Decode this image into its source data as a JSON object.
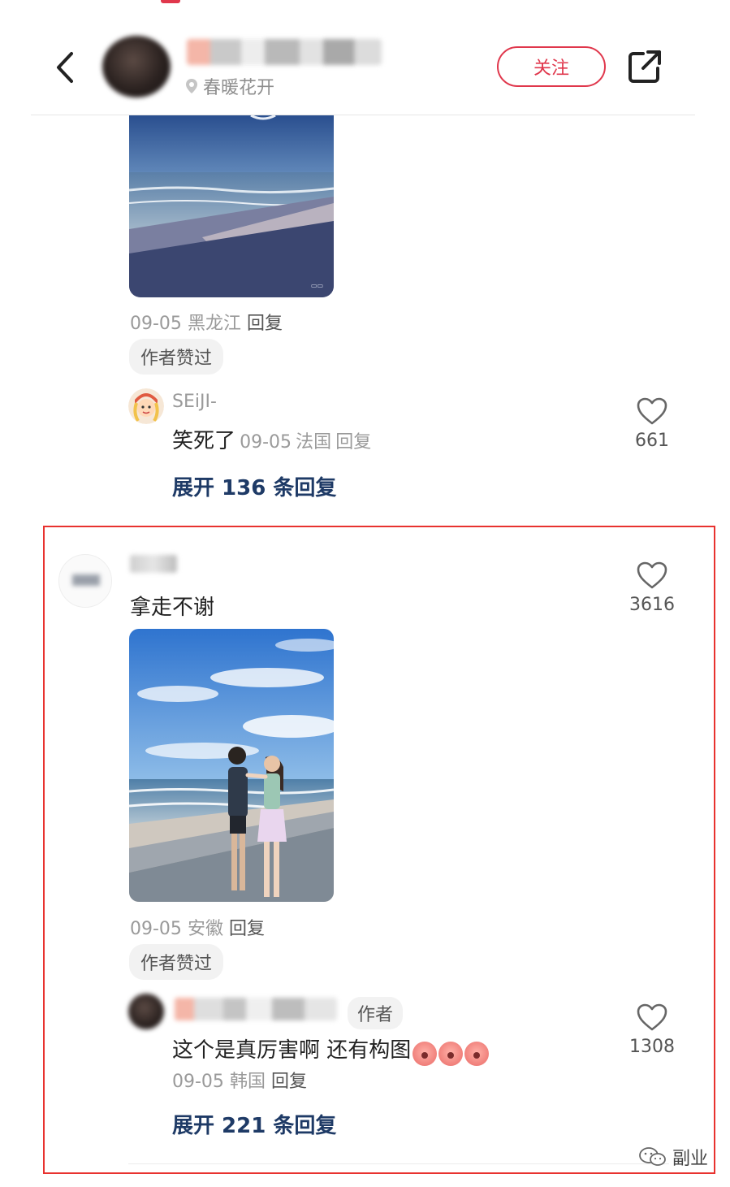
{
  "header": {
    "location": "春暖花开",
    "follow_label": "关注"
  },
  "comments": [
    {
      "meta_date": "09-05",
      "meta_region": "黑龙江",
      "meta_reply": "回复",
      "liked_by_author": "作者赞过",
      "sub_reply": {
        "username": "SEiJI-",
        "text": "笑死了",
        "date": "09-05",
        "region": "法国",
        "reply_label": "回复",
        "likes": "661"
      },
      "expand_label": "展开 136 条回复"
    },
    {
      "text": "拿走不谢",
      "likes": "3616",
      "meta_date": "09-05",
      "meta_region": "安徽",
      "meta_reply": "回复",
      "liked_by_author": "作者赞过",
      "sub_reply": {
        "author_tag": "作者",
        "text": "这个是真厉害啊 还有构图",
        "date": "09-05",
        "region": "韩国",
        "reply_label": "回复",
        "likes": "1308"
      },
      "expand_label": "展开 221 条回复"
    }
  ],
  "watermark": "副业",
  "colors": {
    "accent_red": "#e0374c",
    "highlight_box": "#e8322f",
    "expand_blue": "#1e3a66"
  }
}
